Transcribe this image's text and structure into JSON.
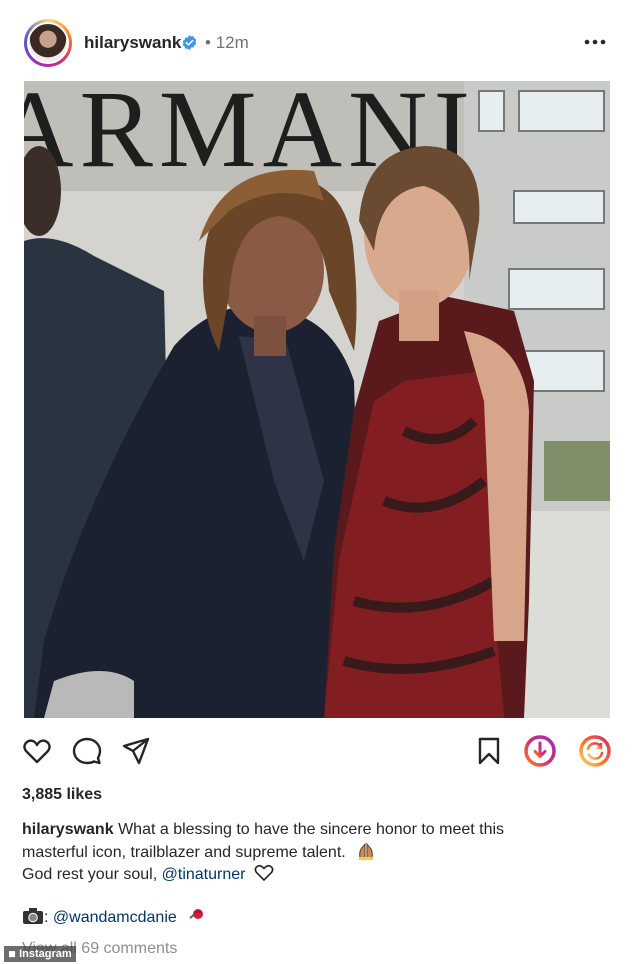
{
  "post": {
    "username": "hilaryswank",
    "time": "12m",
    "likes": "3,885 likes",
    "caption": {
      "username": "hilaryswank",
      "line1": "What a blessing to have the sincere honor to meet this",
      "line2": "masterful icon, trailblazer and supreme talent.",
      "line3_prefix": "God rest your soul,",
      "mention": "@tinaturner"
    },
    "credit": {
      "separator": ":",
      "handle": "@wandamcdanie"
    },
    "comments_link": "View all 69 comments"
  },
  "photo": {
    "sign_text": "ARMANI"
  },
  "watermark": "Instagram",
  "colors": {
    "verified": "#3897f0",
    "link": "#00376b",
    "muted": "#737373",
    "text": "#262626",
    "story_ring": [
      "#feda75",
      "#fa7e1e",
      "#d62976",
      "#962fbf",
      "#4f5bd5"
    ]
  },
  "icons": {
    "header": [
      "verified-badge-icon",
      "more-options-icon"
    ],
    "actions": [
      "heart-icon",
      "comment-icon",
      "share-icon",
      "bookmark-icon",
      "download-icon",
      "repost-icon"
    ],
    "caption": [
      "praying-hands-emoji",
      "heart-outline-icon",
      "camera-emoji",
      "rose-emoji"
    ]
  }
}
